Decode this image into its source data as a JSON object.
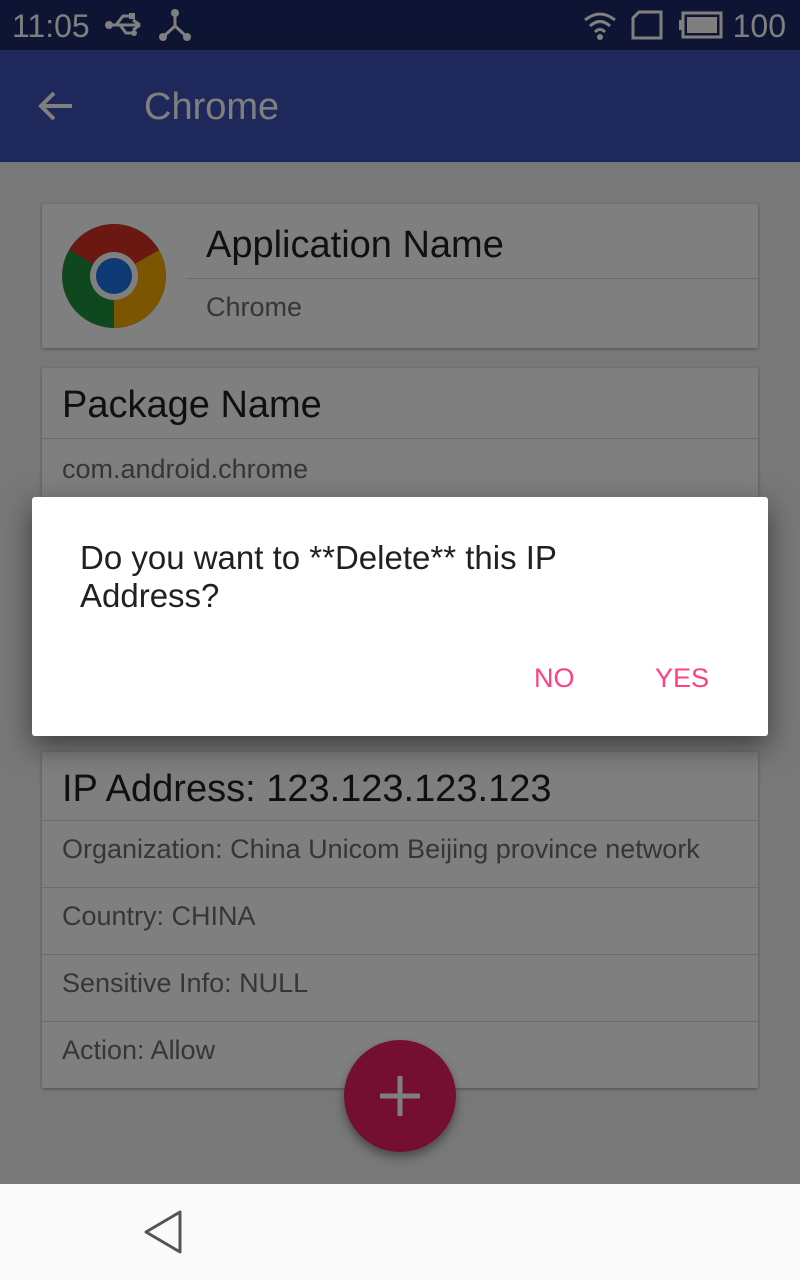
{
  "status_bar": {
    "time": "11:05",
    "battery": "100"
  },
  "app_bar": {
    "title": "Chrome"
  },
  "app_card": {
    "label": "Application Name",
    "value": "Chrome"
  },
  "package_card": {
    "label": "Package Name",
    "value": "com.android.chrome"
  },
  "ip_card": {
    "title": "IP Address: 123.123.123.123",
    "organization": "Organization: China Unicom Beijing province network",
    "country": "Country: CHINA",
    "sensitive": "Sensitive Info: NULL",
    "action": "Action: Allow"
  },
  "dialog": {
    "message": "Do you want to **Delete** this IP Address?",
    "no_label": "NO",
    "yes_label": "YES"
  },
  "colors": {
    "primary": "#3f51b5",
    "primary_dark": "#1d2866",
    "accent": "#ff4081",
    "fab": "#e91e63"
  }
}
